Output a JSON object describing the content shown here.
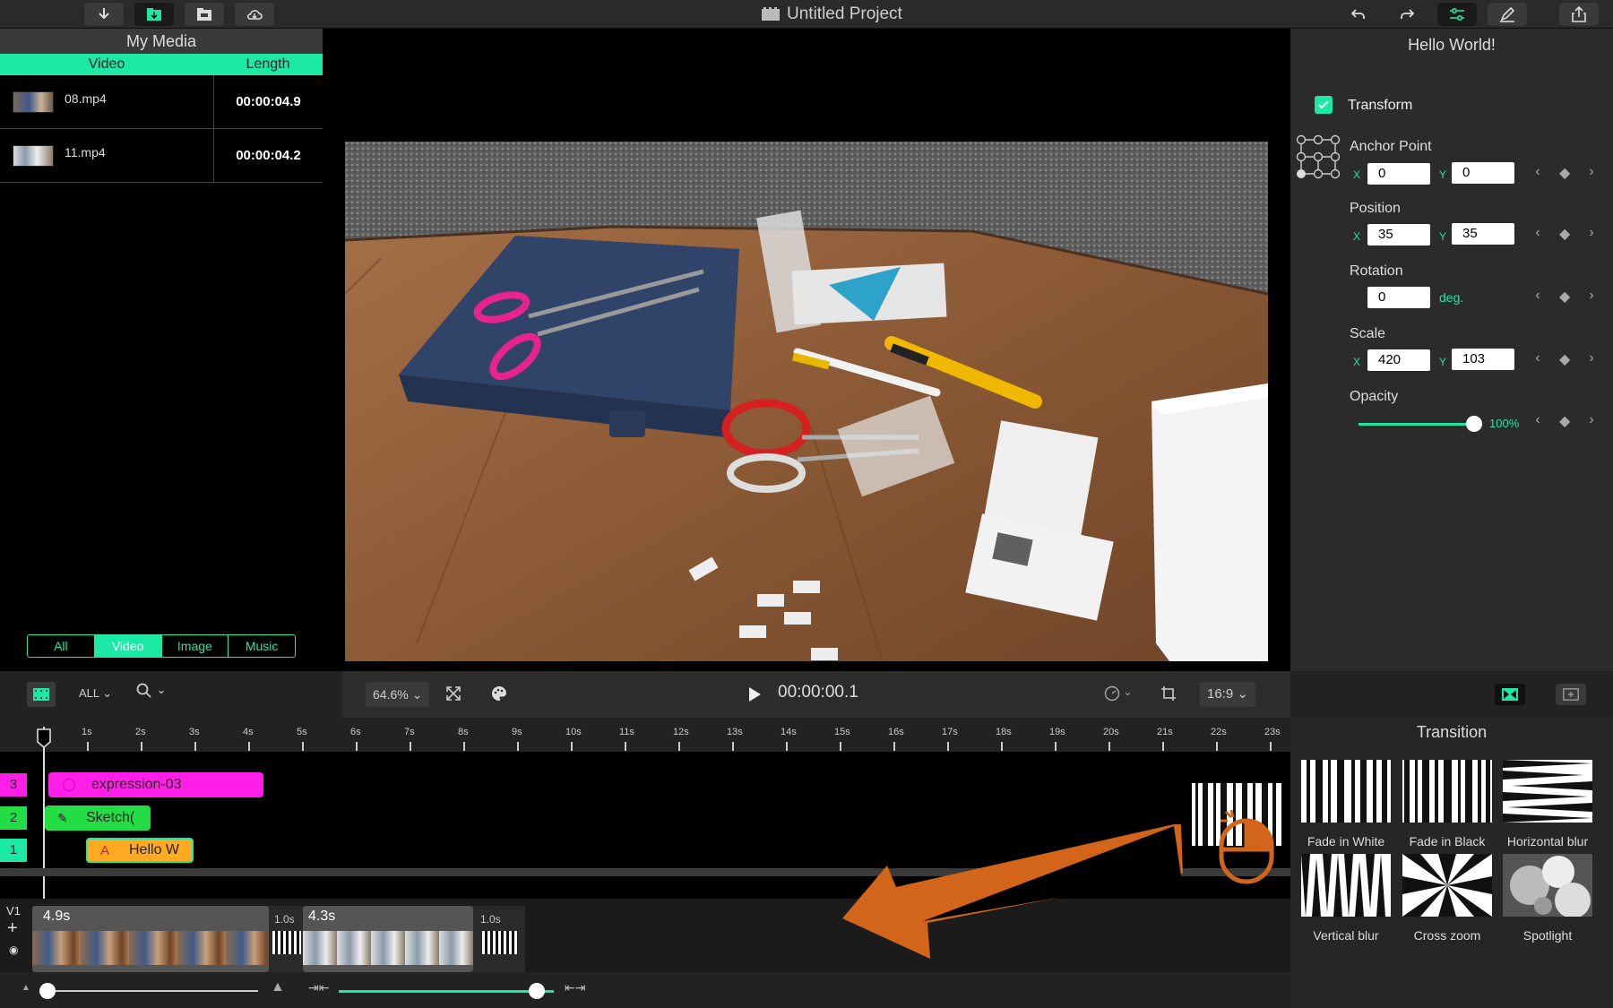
{
  "titlebar": {
    "project_title": "Untitled Project",
    "left_buttons": [
      "download-icon",
      "import-media-icon",
      "folder-icon",
      "cloud-icon"
    ],
    "right_buttons": [
      "undo-icon",
      "redo-icon",
      "adjust-icon",
      "pen-icon",
      "share-icon"
    ]
  },
  "media": {
    "title": "My Media",
    "col_video": "Video",
    "col_length": "Length",
    "rows": [
      {
        "name": "08.mp4",
        "length": "00:00:04.9"
      },
      {
        "name": "11.mp4",
        "length": "00:00:04.2"
      }
    ],
    "filters": [
      "All",
      "Video",
      "Image",
      "Music"
    ],
    "active_filter": "Video"
  },
  "props": {
    "title": "Hello World!",
    "transform_label": "Transform",
    "anchor_label": "Anchor Point",
    "anchor_x": "0",
    "anchor_y": "0",
    "position_label": "Position",
    "position_x": "35",
    "position_y": "35",
    "rotation_label": "Rotation",
    "rotation_value": "0",
    "rotation_unit": "deg.",
    "scale_label": "Scale",
    "scale_x": "420",
    "scale_y": "103",
    "opacity_label": "Opacity",
    "opacity_value": "100%",
    "x_label": "X",
    "y_label": "Y"
  },
  "controls": {
    "filter_label": "ALL",
    "zoom": "64.6%",
    "timecode": "00:00:00.1",
    "aspect": "16:9"
  },
  "timeline": {
    "ruler_labels": [
      "1s",
      "2s",
      "3s",
      "4s",
      "5s",
      "6s",
      "7s",
      "8s",
      "9s",
      "10s",
      "11s",
      "12s",
      "13s",
      "14s",
      "15s",
      "16s",
      "17s",
      "18s",
      "19s",
      "20s",
      "21s",
      "22s",
      "23s"
    ],
    "tracks": [
      {
        "num": "3",
        "clip": "expression-03",
        "color": "#ff1fe8"
      },
      {
        "num": "2",
        "clip": "Sketch(",
        "color": "#22dd44"
      },
      {
        "num": "1",
        "clip": "Hello W",
        "color": "#ffaa22"
      }
    ],
    "v1_label": "V1",
    "clip1_duration": "4.9s",
    "clip2_duration": "4.3s",
    "trans1_duration": "1.0s",
    "trans2_duration": "1.0s"
  },
  "transition": {
    "title": "Transition",
    "items": [
      "Fade in White",
      "Fade in Black",
      "Horizontal blur",
      "Vertical blur",
      "Cross zoom",
      "Spotlight"
    ]
  },
  "colors": {
    "accent": "#1de9a6",
    "arrow": "#d2651a"
  }
}
